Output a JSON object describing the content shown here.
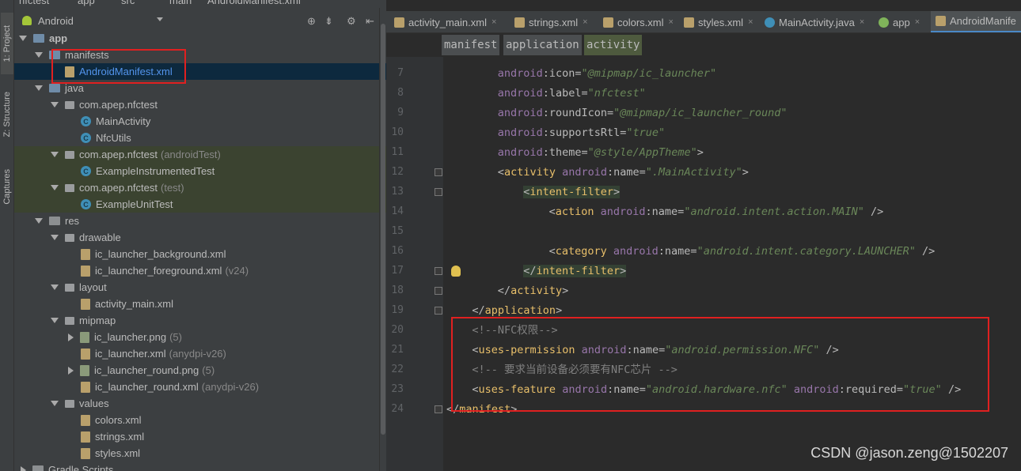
{
  "breadcrumb": {
    "items": [
      "nfctest",
      "app",
      "src",
      "main",
      "AndroidManifest.xml"
    ]
  },
  "side_tabs": [
    "1: Project",
    "Z: Structure",
    "Captures"
  ],
  "project_panel": {
    "view_selector": "Android",
    "tree": [
      {
        "label": "app",
        "depth": 0,
        "arrow": "down",
        "icon": "folder-blue",
        "style": "bold"
      },
      {
        "label": "manifests",
        "depth": 1,
        "arrow": "down",
        "icon": "folder-blue"
      },
      {
        "label": "AndroidManifest.xml",
        "depth": 2,
        "arrow": "none",
        "icon": "xml",
        "selected": true
      },
      {
        "label": "java",
        "depth": 1,
        "arrow": "down",
        "icon": "folder-blue"
      },
      {
        "label": "com.apep.nfctest",
        "depth": 2,
        "arrow": "down",
        "icon": "package"
      },
      {
        "label": "MainActivity",
        "depth": 3,
        "arrow": "none",
        "icon": "class"
      },
      {
        "label": "NfcUtils",
        "depth": 3,
        "arrow": "none",
        "icon": "class"
      },
      {
        "label": "com.apep.nfctest",
        "suffix": "(androidTest)",
        "depth": 2,
        "arrow": "down",
        "icon": "package",
        "green": true
      },
      {
        "label": "ExampleInstrumentedTest",
        "depth": 3,
        "arrow": "none",
        "icon": "class",
        "green": true
      },
      {
        "label": "com.apep.nfctest",
        "suffix": "(test)",
        "depth": 2,
        "arrow": "down",
        "icon": "package",
        "green": true
      },
      {
        "label": "ExampleUnitTest",
        "depth": 3,
        "arrow": "none",
        "icon": "class",
        "green": true
      },
      {
        "label": "res",
        "depth": 1,
        "arrow": "down",
        "icon": "folder"
      },
      {
        "label": "drawable",
        "depth": 2,
        "arrow": "down",
        "icon": "package"
      },
      {
        "label": "ic_launcher_background.xml",
        "depth": 3,
        "arrow": "none",
        "icon": "xml"
      },
      {
        "label": "ic_launcher_foreground.xml",
        "suffix": "(v24)",
        "depth": 3,
        "arrow": "none",
        "icon": "xml"
      },
      {
        "label": "layout",
        "depth": 2,
        "arrow": "down",
        "icon": "package"
      },
      {
        "label": "activity_main.xml",
        "depth": 3,
        "arrow": "none",
        "icon": "xml"
      },
      {
        "label": "mipmap",
        "depth": 2,
        "arrow": "down",
        "icon": "package"
      },
      {
        "label": "ic_launcher.png",
        "suffix": "(5)",
        "depth": 3,
        "arrow": "right",
        "icon": "image"
      },
      {
        "label": "ic_launcher.xml",
        "suffix": "(anydpi-v26)",
        "depth": 3,
        "arrow": "none",
        "icon": "xml"
      },
      {
        "label": "ic_launcher_round.png",
        "suffix": "(5)",
        "depth": 3,
        "arrow": "right",
        "icon": "image"
      },
      {
        "label": "ic_launcher_round.xml",
        "suffix": "(anydpi-v26)",
        "depth": 3,
        "arrow": "none",
        "icon": "xml"
      },
      {
        "label": "values",
        "depth": 2,
        "arrow": "down",
        "icon": "package"
      },
      {
        "label": "colors.xml",
        "depth": 3,
        "arrow": "none",
        "icon": "xml"
      },
      {
        "label": "strings.xml",
        "depth": 3,
        "arrow": "none",
        "icon": "xml"
      },
      {
        "label": "styles.xml",
        "depth": 3,
        "arrow": "none",
        "icon": "xml"
      },
      {
        "label": "Gradle Scripts",
        "depth": 0,
        "arrow": "right",
        "icon": "folder"
      }
    ]
  },
  "editor_tabs": [
    {
      "label": "activity_main.xml",
      "icon": "xml"
    },
    {
      "label": "strings.xml",
      "icon": "xml"
    },
    {
      "label": "colors.xml",
      "icon": "xml"
    },
    {
      "label": "styles.xml",
      "icon": "xml"
    },
    {
      "label": "MainActivity.java",
      "icon": "class"
    },
    {
      "label": "app",
      "icon": "gradle"
    },
    {
      "label": "AndroidManife",
      "icon": "xml",
      "active": true
    }
  ],
  "xml_breadcrumb": [
    "manifest",
    "application",
    "activity"
  ],
  "code_lines": [
    {
      "n": "7",
      "indent": 8,
      "tokens": [
        [
          "at",
          "android"
        ],
        [
          "nm",
          ":icon="
        ],
        [
          "vl",
          "\"@mipmap/ic_launcher\""
        ]
      ]
    },
    {
      "n": "8",
      "indent": 8,
      "tokens": [
        [
          "at",
          "android"
        ],
        [
          "nm",
          ":label="
        ],
        [
          "vl",
          "\"nfctest\""
        ]
      ]
    },
    {
      "n": "9",
      "indent": 8,
      "tokens": [
        [
          "at",
          "android"
        ],
        [
          "nm",
          ":roundIcon="
        ],
        [
          "vl",
          "\"@mipmap/ic_launcher_round\""
        ]
      ]
    },
    {
      "n": "10",
      "indent": 8,
      "tokens": [
        [
          "at",
          "android"
        ],
        [
          "nm",
          ":supportsRtl="
        ],
        [
          "vl",
          "\"true\""
        ]
      ]
    },
    {
      "n": "11",
      "indent": 8,
      "tokens": [
        [
          "at",
          "android"
        ],
        [
          "nm",
          ":theme="
        ],
        [
          "vl",
          "\"@style/AppTheme\""
        ],
        [
          "nm",
          ">"
        ]
      ]
    },
    {
      "n": "12",
      "indent": 8,
      "tokens": [
        [
          "nm",
          "<"
        ],
        [
          "tg",
          "activity "
        ],
        [
          "at",
          "android"
        ],
        [
          "nm",
          ":name="
        ],
        [
          "vl",
          "\".MainActivity\""
        ],
        [
          "nm",
          ">"
        ]
      ]
    },
    {
      "n": "13",
      "indent": 12,
      "tokens": [
        [
          "nm",
          "<"
        ],
        [
          "tg",
          "intent-filter"
        ],
        [
          "nm",
          ">"
        ]
      ],
      "hl": true
    },
    {
      "n": "14",
      "indent": 16,
      "tokens": [
        [
          "nm",
          "<"
        ],
        [
          "tg",
          "action "
        ],
        [
          "at",
          "android"
        ],
        [
          "nm",
          ":name="
        ],
        [
          "vl",
          "\"android.intent.action.MAIN\""
        ],
        [
          "nm",
          " />"
        ]
      ]
    },
    {
      "n": "15",
      "indent": 0,
      "tokens": []
    },
    {
      "n": "16",
      "indent": 16,
      "tokens": [
        [
          "nm",
          "<"
        ],
        [
          "tg",
          "category "
        ],
        [
          "at",
          "android"
        ],
        [
          "nm",
          ":name="
        ],
        [
          "vl",
          "\"android.intent.category.LAUNCHER\""
        ],
        [
          "nm",
          " />"
        ]
      ]
    },
    {
      "n": "17",
      "indent": 12,
      "tokens": [
        [
          "nm",
          "</"
        ],
        [
          "tg",
          "intent-filter"
        ],
        [
          "nm",
          ">"
        ]
      ],
      "hl": true
    },
    {
      "n": "18",
      "indent": 8,
      "tokens": [
        [
          "nm",
          "</"
        ],
        [
          "tg",
          "activity"
        ],
        [
          "nm",
          ">"
        ]
      ]
    },
    {
      "n": "19",
      "indent": 4,
      "tokens": [
        [
          "nm",
          "</"
        ],
        [
          "tg",
          "application"
        ],
        [
          "nm",
          ">"
        ]
      ]
    },
    {
      "n": "20",
      "indent": 4,
      "tokens": [
        [
          "cm",
          "<!--NFC权限-->"
        ]
      ]
    },
    {
      "n": "21",
      "indent": 4,
      "tokens": [
        [
          "nm",
          "<"
        ],
        [
          "tg",
          "uses-permission"
        ],
        [
          "nm",
          " "
        ],
        [
          "at",
          "android"
        ],
        [
          "nm",
          ":name="
        ],
        [
          "vl",
          "\"android.permission.NFC\""
        ],
        [
          "nm",
          " />"
        ]
      ]
    },
    {
      "n": "22",
      "indent": 4,
      "tokens": [
        [
          "cm",
          "<!-- 要求当前设备必须要有NFC芯片 -->"
        ]
      ]
    },
    {
      "n": "23",
      "indent": 4,
      "tokens": [
        [
          "nm",
          "<"
        ],
        [
          "tg",
          "uses-feature "
        ],
        [
          "at",
          "android"
        ],
        [
          "nm",
          ":name="
        ],
        [
          "vl",
          "\"android.hardware.nfc\""
        ],
        [
          "nm",
          " "
        ],
        [
          "at",
          "android"
        ],
        [
          "nm",
          ":required="
        ],
        [
          "vl",
          "\"true\""
        ],
        [
          "nm",
          " />"
        ]
      ]
    },
    {
      "n": "24",
      "indent": 0,
      "tokens": [
        [
          "nm",
          "</"
        ],
        [
          "tg",
          "manifest"
        ],
        [
          "nm",
          ">"
        ]
      ]
    }
  ],
  "watermark": "CSDN @jason.zeng@1502207",
  "colors": {
    "selection": "#0d293e",
    "annotation_box": "#e02020",
    "tag": "#e8bf6a",
    "attr": "#9876aa",
    "value": "#6a8759"
  }
}
